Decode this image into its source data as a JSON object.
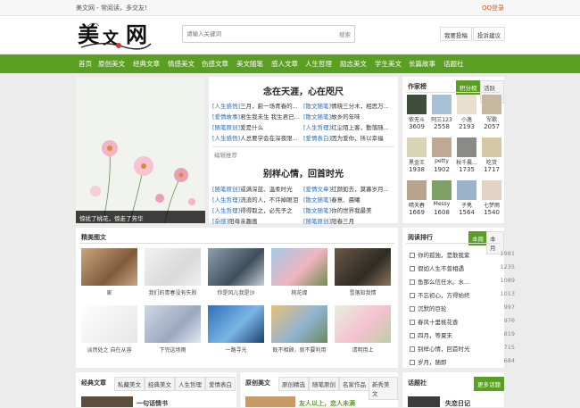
{
  "topbar": {
    "site_slogan": "美文网 - 常阅读，多交友!",
    "login": "QQ登录"
  },
  "header": {
    "logo_text": "美文网",
    "search_placeholder": "请输入关键词",
    "search_button": "搜索",
    "contribute": "我要投稿",
    "feedback": "投诉建议"
  },
  "nav": [
    "首页",
    "原创美文",
    "经典文章",
    "情感美文",
    "伤感文章",
    "美文随笔",
    "感人文章",
    "人生哲理",
    "励志美文",
    "学生美文",
    "长篇故事",
    "话题社"
  ],
  "slider": {
    "caption": "惊扰了桃花，惊走了芳华"
  },
  "featured": {
    "title1": "念在天涯，心在咫尺",
    "list1": [
      {
        "tag": "[人生感悟]",
        "text": "三月，蔚一场青春的..."
      },
      {
        "tag": "[散文随笔]",
        "text": "情晓三分木，相思万..."
      },
      {
        "tag": "[爱情故事]",
        "text": "君生我未生 我生君已..."
      },
      {
        "tag": "[散文随笔]",
        "text": "故乡的年味"
      },
      {
        "tag": "[随笔原创]",
        "text": "爱是什么"
      },
      {
        "tag": "[人生哲理]",
        "text": "红尘陌上客，勤落随..."
      },
      {
        "tag": "[人生感悟]",
        "text": "人总要学会在深夜限..."
      },
      {
        "tag": "[爱情表白]",
        "text": "因为爱你，所以幸福"
      }
    ],
    "editor_pick": "编辑推荐",
    "title2": "别样心情，回首时光",
    "list2": [
      {
        "tag": "[随笔原创]",
        "text": "或满深蓝、温柔时光"
      },
      {
        "tag": "[爱情文章]",
        "text": "红颜如去，莫寡岁月..."
      },
      {
        "tag": "[人生哲理]",
        "text": "流浪的人，不许掉眼泪"
      },
      {
        "tag": "[散文随笔]",
        "text": "春意、晨曦"
      },
      {
        "tag": "[人生哲理]",
        "text": "得得取之，必先予之"
      },
      {
        "tag": "[散文随笔]",
        "text": "你的世界我最美"
      },
      {
        "tag": "[杂感]",
        "text": "阳母亲趣画"
      },
      {
        "tag": "[随笔原创]",
        "text": "阳春三月"
      }
    ]
  },
  "authors": {
    "title": "作家榜",
    "tab_score": "积分榜",
    "tab_active": "活跃榜",
    "users": [
      {
        "name": "依无斗",
        "score": "3609"
      },
      {
        "name": "阿三123",
        "score": "2558"
      },
      {
        "name": "小逸",
        "score": "2193"
      },
      {
        "name": "军歌",
        "score": "2057"
      },
      {
        "name": "黑金王",
        "score": "1938"
      },
      {
        "name": "petty",
        "score": "1902"
      },
      {
        "name": "秋千晨...",
        "score": "1735"
      },
      {
        "name": "吃货",
        "score": "1717"
      },
      {
        "name": "晴天春",
        "score": "1669"
      },
      {
        "name": "Messy",
        "score": "1608"
      },
      {
        "name": "子隽",
        "score": "1564"
      },
      {
        "name": "七梦雨",
        "score": "1540"
      }
    ]
  },
  "gallery": {
    "title": "精美图文",
    "items": [
      "家",
      "我们的青春没有失败",
      "你是风儿我是沙",
      "桃花缘",
      "雪落知我情",
      "淡然处之 自在从容",
      "下完这场雨",
      "一路寻光",
      "既不相顾，就不要利用",
      "请明用上"
    ]
  },
  "reading": {
    "title": "阅读排行",
    "tab_week": "本周",
    "tab_month": "本月",
    "items": [
      {
        "t": "你的孤独，是散我紫",
        "n": "1981"
      },
      {
        "t": "假如人生不曾相遇",
        "n": "1235"
      },
      {
        "t": "鱼那么信任水。水...",
        "n": "1089"
      },
      {
        "t": "不忘初心，方得始终",
        "n": "1013"
      },
      {
        "t": "沉默的巨轮",
        "n": "997"
      },
      {
        "t": "春风十里桃花香",
        "n": "976"
      },
      {
        "t": "四月，等夏末",
        "n": "819"
      },
      {
        "t": "别样心情，回首时光",
        "n": "715"
      },
      {
        "t": "岁月，随即",
        "n": "684"
      }
    ]
  },
  "bottom": {
    "classic_title": "经典文章",
    "classic_tabs": [
      "私藏美文",
      "经典美文",
      "人生哲理",
      "爱情表白"
    ],
    "classic_first": "一句话情书",
    "original_title": "原创美文",
    "original_tabs": [
      "原创精选",
      "随笔原创",
      "名家作品",
      "新秀美文"
    ],
    "original_first": "友人以上，恋人未满",
    "topic_title": "话题社",
    "topic_more": "更多话题",
    "topic_first": "失恋日记"
  }
}
